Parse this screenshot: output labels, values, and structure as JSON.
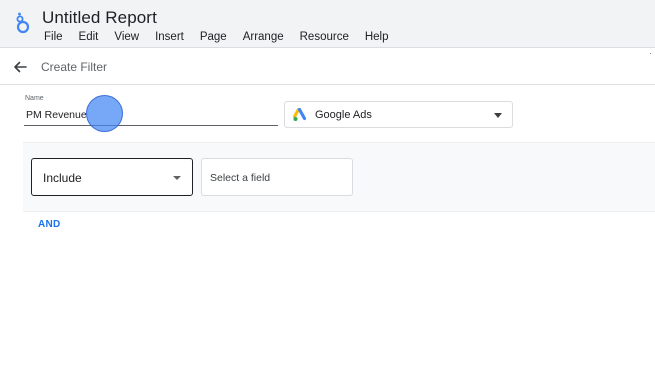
{
  "app": {
    "title": "Untitled Report",
    "menu": [
      "File",
      "Edit",
      "View",
      "Insert",
      "Page",
      "Arrange",
      "Resource",
      "Help"
    ]
  },
  "subheader": {
    "title": "Create Filter",
    "corner_mark": "·"
  },
  "form": {
    "name_label": "Name",
    "name_value": "PM Revenue",
    "data_source": "Google Ads",
    "condition_mode": "Include",
    "field_placeholder": "Select a field",
    "and_label": "AND"
  },
  "colors": {
    "accent": "#1a73e8",
    "header_bg": "#f1f3f4",
    "condition_bg": "#f8f9fa",
    "cursor_highlight": "#4285f4"
  },
  "icons": {
    "logo": "looker-studio-logo-icon",
    "back": "arrow-left-icon",
    "source": "google-ads-icon",
    "dropdown": "caret-down-icon"
  }
}
